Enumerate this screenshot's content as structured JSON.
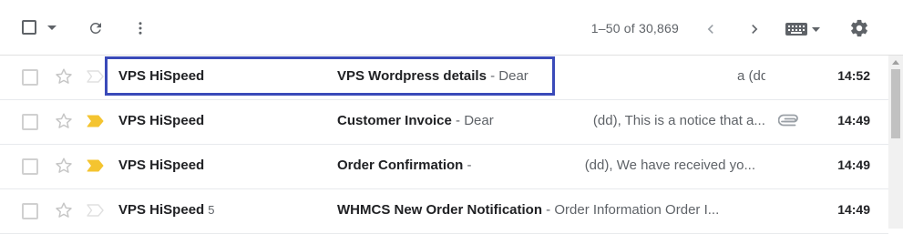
{
  "toolbar": {
    "pagination": "1–50 of 30,869"
  },
  "emails": [
    {
      "sender": "VPS HiSpeed",
      "count": "",
      "subject": "VPS Wordpress details",
      "snippet_start": " - Dear ",
      "snippet_end": "a (dd), Thank y...",
      "time": "14:52",
      "important": false,
      "attachment": false
    },
    {
      "sender": "VPS HiSpeed",
      "count": "",
      "subject": "Customer Invoice",
      "snippet_start": " - Dear ",
      "snippet_end": "(dd), This is a notice that a...",
      "time": "14:49",
      "important": true,
      "attachment": true
    },
    {
      "sender": "VPS HiSpeed",
      "count": "",
      "subject": "Order Confirmation",
      "snippet_start": " - ",
      "snippet_end": "(dd), We have received yo...",
      "time": "14:49",
      "important": true,
      "attachment": false
    },
    {
      "sender": "VPS HiSpeed",
      "count": "5",
      "subject": "WHMCS New Order Notification",
      "snippet_start": " - Order Information Order I...",
      "snippet_end": "",
      "time": "14:49",
      "important": false,
      "attachment": false
    }
  ],
  "colors": {
    "important_marker": "#f4c430",
    "highlight_box": "#3a4ab9",
    "icon_gray": "#5f6368"
  },
  "icons": {
    "select_all": "checkbox-icon",
    "select_menu": "caret-down-icon",
    "refresh": "refresh-icon",
    "more": "more-vert-icon",
    "prev": "chevron-left-icon",
    "next": "chevron-right-icon",
    "input_tools": "keyboard-icon",
    "settings": "gear-icon",
    "star": "star-outline-icon",
    "important": "important-marker-icon",
    "attachment": "paperclip-icon"
  }
}
